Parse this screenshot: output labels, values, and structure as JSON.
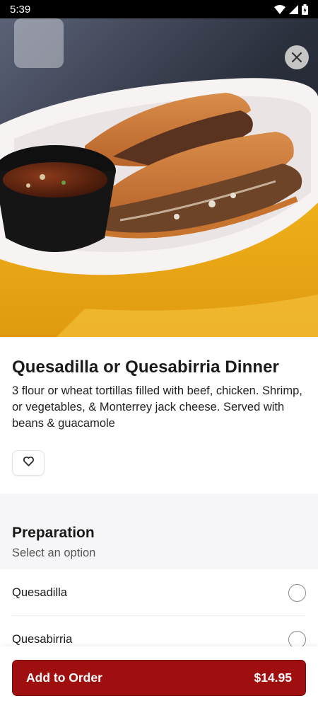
{
  "status_bar": {
    "time": "5:39"
  },
  "item": {
    "title": "Quesadilla or Quesabirria Dinner",
    "description": "3 flour or wheat tortillas filled with beef, chicken. Shrimp, or vegetables, & Monterrey jack cheese. Served with beans & guacamole"
  },
  "preparation": {
    "title": "Preparation",
    "subtitle": "Select an option",
    "options": [
      {
        "label": "Quesadilla",
        "selected": false
      },
      {
        "label": "Quesabirria",
        "selected": false
      }
    ]
  },
  "cta": {
    "label": "Add to Order",
    "price": "$14.95",
    "color": "#a00f0f"
  }
}
